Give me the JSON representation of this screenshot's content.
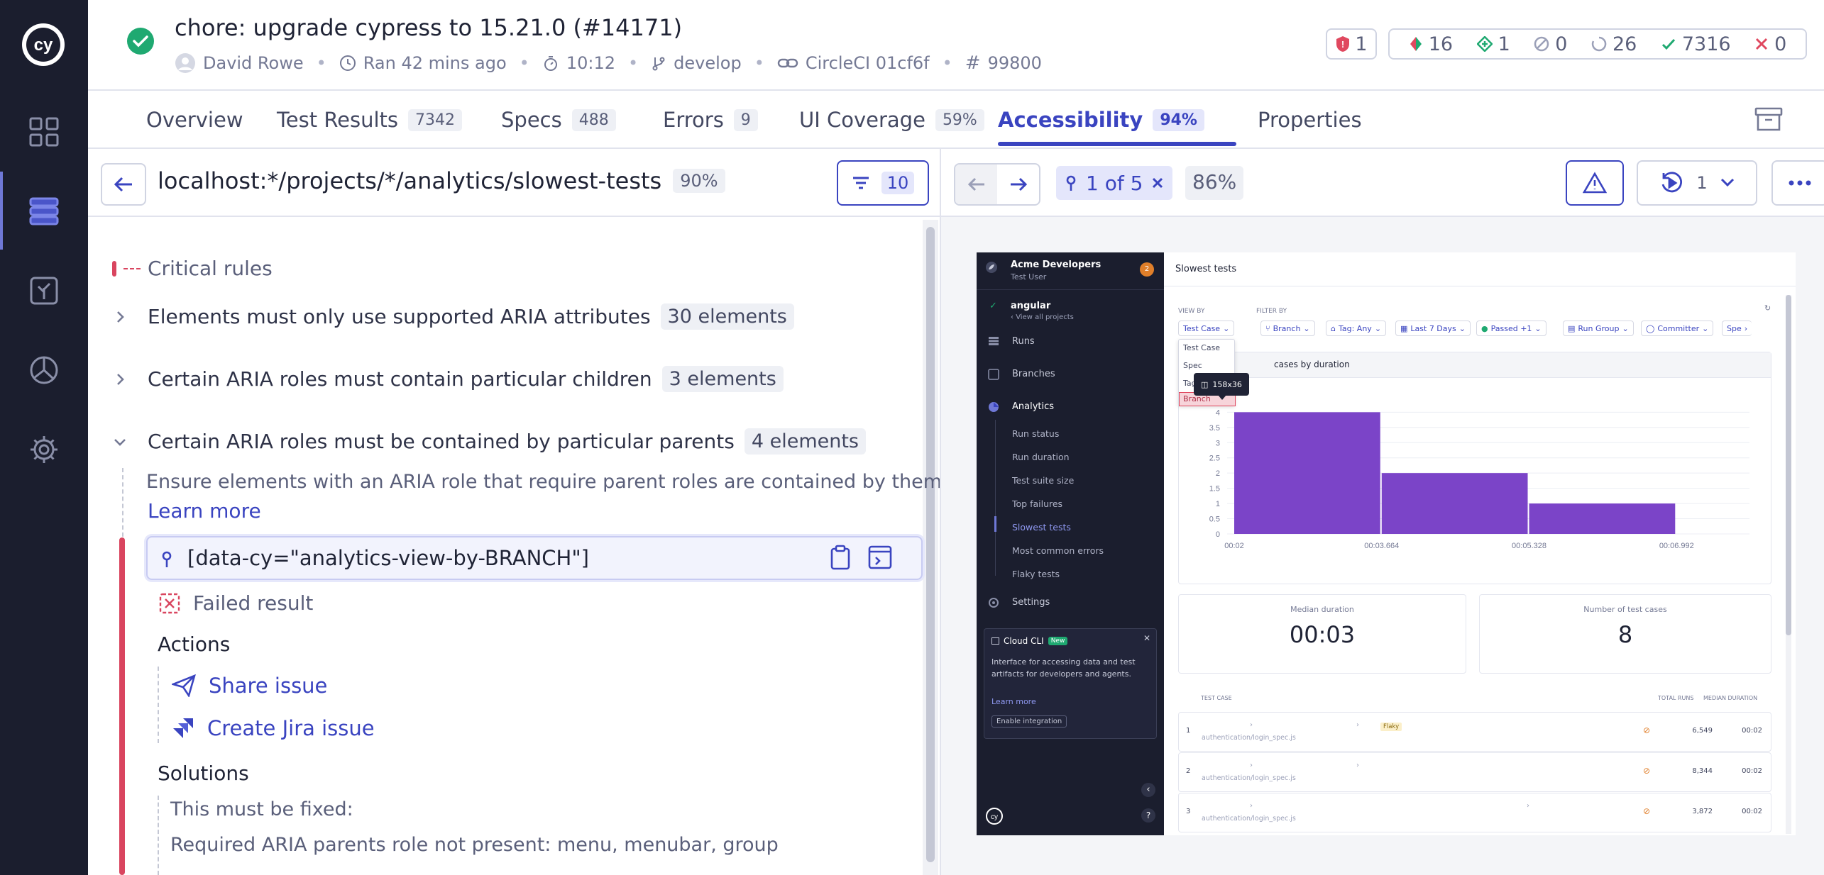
{
  "header": {
    "title": "chore: upgrade cypress to 15.21.0 (#14171)",
    "author": "David Rowe",
    "ran": "Ran 42 mins ago",
    "duration": "10:12",
    "branch": "develop",
    "ci": "CircleCI 01cf6f",
    "run_number": "99800",
    "stats": {
      "a11y_issues": "1",
      "flaky": "16",
      "added": "1",
      "skipped": "0",
      "pending": "26",
      "passed": "7316",
      "failed": "0"
    }
  },
  "tabs": [
    {
      "label": "Overview",
      "badge": ""
    },
    {
      "label": "Test Results",
      "badge": "7342"
    },
    {
      "label": "Specs",
      "badge": "488"
    },
    {
      "label": "Errors",
      "badge": "9"
    },
    {
      "label": "UI Coverage",
      "badge": "59%"
    },
    {
      "label": "Accessibility",
      "badge": "94%"
    },
    {
      "label": "Properties",
      "badge": ""
    }
  ],
  "left": {
    "url": "localhost:*/projects/*/analytics/slowest-tests",
    "url_score": "90%",
    "filter_count": "10",
    "section_title": "Critical rules",
    "rules": [
      {
        "title": "Elements must only use supported ARIA attributes",
        "count": "30 elements"
      },
      {
        "title": "Certain ARIA roles must contain particular children",
        "count": "3 elements"
      },
      {
        "title": "Certain ARIA roles must be contained by particular parents",
        "count": "4 elements"
      }
    ],
    "rule_description": "Ensure elements with an ARIA role that require parent roles are contained by them",
    "learn_more": "Learn more",
    "selector": "[data-cy=\"analytics-view-by-BRANCH\"]",
    "failed_result": "Failed result",
    "actions_title": "Actions",
    "share_issue": "Share issue",
    "create_jira": "Create Jira issue",
    "solutions_title": "Solutions",
    "solution_1": "This must be fixed:",
    "solution_2": "Required ARIA parents role not present: menu, menubar, group"
  },
  "right": {
    "position": "1 of 5",
    "score": "86%",
    "replay_count": "1"
  },
  "preview": {
    "org": "Acme Developers",
    "user": "Test User",
    "org_badge": "2",
    "project": "angular",
    "view_all": "View all projects",
    "nav": [
      "Runs",
      "Branches",
      "Analytics"
    ],
    "sub_nav": [
      "Run status",
      "Run duration",
      "Test suite size",
      "Top failures",
      "Slowest tests",
      "Most common errors",
      "Flaky tests"
    ],
    "settings": "Settings",
    "cli_title": "Cloud CLI",
    "cli_badge": "New",
    "cli_desc": "Interface for accessing data and test artifacts for developers and agents.",
    "cli_learn": "Learn more",
    "cli_enable": "Enable integration",
    "page_title": "Slowest tests",
    "view_by_label": "VIEW BY",
    "filter_by_label": "FILTER BY",
    "view_by_value": "Test Case",
    "dropdown": [
      "Test Case",
      "Spec",
      "Tag",
      "Branch"
    ],
    "tooltip": "158x36",
    "filters": [
      "Branch",
      "Tag: Any",
      "Last 7 Days",
      "Passed +1",
      "Run Group",
      "Committer",
      "Spe"
    ],
    "chart_title": "cases by duration",
    "median_label": "Median duration",
    "median_value": "00:03",
    "count_label": "Number of test cases",
    "count_value": "8",
    "table_headers": [
      "TEST CASE",
      "TOTAL RUNS",
      "MEDIAN DURATION"
    ],
    "rows": [
      {
        "n": "1",
        "spec": "authentication/login_spec.js",
        "runs": "6,549",
        "dur": "00:02",
        "flaky": "Flaky"
      },
      {
        "n": "2",
        "spec": "authentication/login_spec.js",
        "runs": "8,344",
        "dur": "00:02",
        "flaky": ""
      },
      {
        "n": "3",
        "spec": "authentication/login_spec.js",
        "runs": "3,872",
        "dur": "00:02",
        "flaky": ""
      }
    ]
  },
  "chart_data": {
    "type": "bar",
    "categories": [
      "00:02",
      "00:03.664",
      "00:05.328"
    ],
    "x_ticks": [
      "00:02",
      "00:03.664",
      "00:05.328",
      "00:06.992"
    ],
    "values": [
      4,
      2,
      1
    ],
    "y_ticks": [
      "0",
      "0.5",
      "1",
      "1.5",
      "2",
      "2.5",
      "3",
      "3.5",
      "4"
    ],
    "ylim": [
      0,
      4.8
    ],
    "color": "#7b44c8"
  },
  "colors": {
    "accent": "#3a44c0",
    "critical": "#d9455f",
    "sidebar": "#1b1e2e",
    "bar": "#7b44c8"
  }
}
